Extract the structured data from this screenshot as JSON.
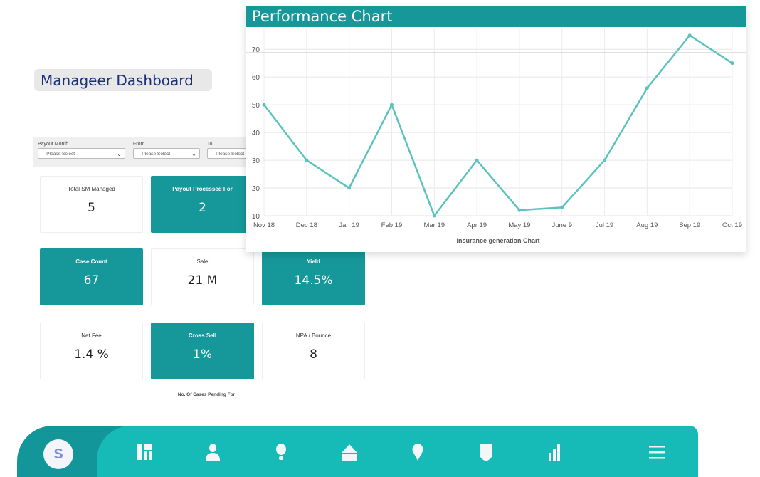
{
  "dashboard": {
    "title": "Manageer Dashboard",
    "filters": [
      {
        "label": "Payout Month",
        "value": "--- Please Select ---"
      },
      {
        "label": "From",
        "value": "--- Please Select ---"
      },
      {
        "label": "To",
        "value": "--- Please Select ---"
      }
    ],
    "cards": [
      {
        "label": "Total SM Managed",
        "value": "5",
        "style": "white"
      },
      {
        "label": "Payout Processed For",
        "value": "2",
        "style": "teal"
      },
      {
        "label": "Case Count",
        "value": "67",
        "style": "teal"
      },
      {
        "label": "Sale",
        "value": "21 M",
        "style": "white"
      },
      {
        "label": "Yield",
        "value": "14.5%",
        "style": "teal"
      },
      {
        "label": "Net Fee",
        "value": "1.4 %",
        "style": "white"
      },
      {
        "label": "Cross Sell",
        "value": "1%",
        "style": "teal"
      },
      {
        "label": "NPA / Bounce",
        "value": "8",
        "style": "white"
      }
    ],
    "pending_label": "No. Of Cases Pending For"
  },
  "chart": {
    "header": "Performance Chart"
  },
  "chart_data": {
    "type": "line",
    "title": "Performance Chart",
    "xlabel": "Insurance generation Chart",
    "ylabel": "",
    "categories": [
      "Nov 18",
      "Dec 18",
      "Jan 19",
      "Feb 19",
      "Mar 19",
      "Apr 19",
      "May 19",
      "June 9",
      "Jul 19",
      "Aug 19",
      "Sep 19",
      "Oct 19"
    ],
    "values": [
      50,
      30,
      20,
      50,
      10,
      30,
      12,
      13,
      30,
      56,
      75,
      65
    ],
    "yticks": [
      10,
      20,
      30,
      40,
      50,
      60,
      70
    ],
    "ylim": [
      10,
      77.5
    ],
    "reference_line": 68.7,
    "grid": true,
    "color": "#5cc2bd"
  },
  "nav": {
    "avatar": "S",
    "icons": [
      "dashboard-icon",
      "user-icon",
      "bulb-icon",
      "home-icon",
      "location-icon",
      "shield-icon",
      "bar-chart-icon",
      "menu-icon"
    ],
    "accent": "#16bab7"
  }
}
